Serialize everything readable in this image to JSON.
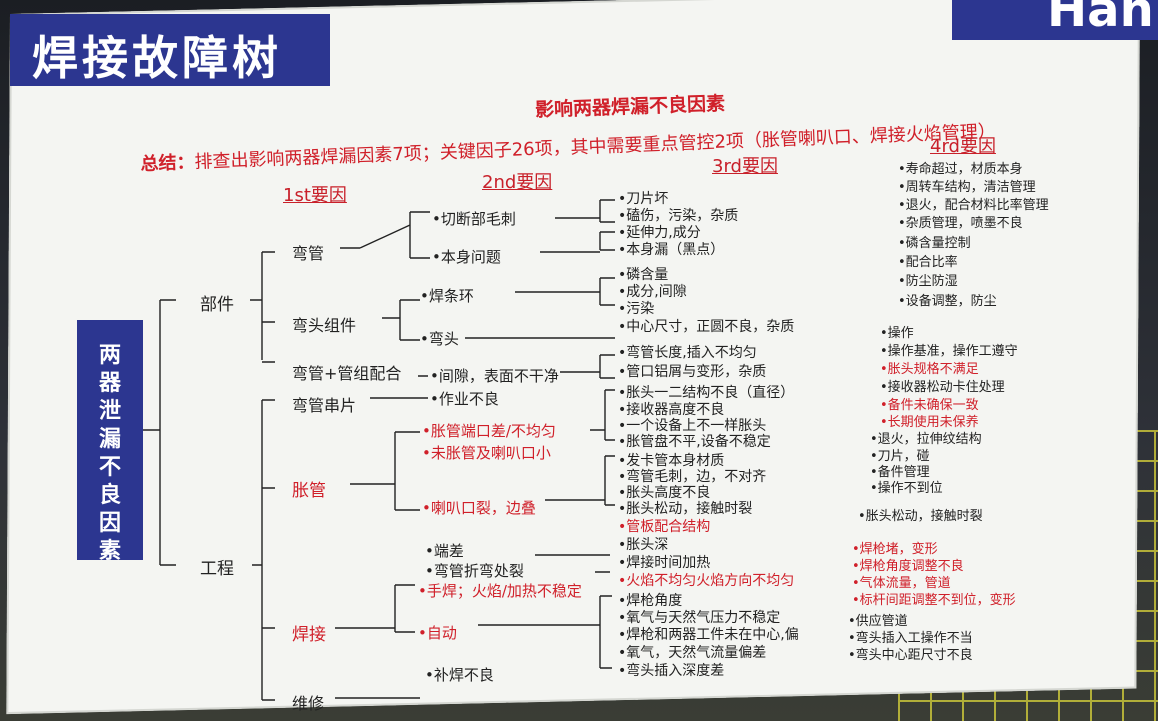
{
  "title": "焊接故障树",
  "corner_text": "Han",
  "subtitle": "影响两器焊漏不良因素",
  "summary": {
    "prefix": "总结：",
    "text": "排查出影响两器焊漏因素7项；关键因子26项，其中需要重点管控2项（胀管喇叭口、焊接火焰管理）"
  },
  "headers": [
    "1st要因",
    "2nd要因",
    "3rd要因",
    "4rd要因"
  ],
  "root": "两器泄漏不良因素",
  "level1": [
    "部件",
    "工程"
  ],
  "level2": [
    "弯管",
    "弯头组件",
    "弯管+管组配合",
    "弯管串片",
    "胀管",
    "焊接",
    "维修"
  ],
  "level3": {
    "wanguan": [
      "•切断部毛刺",
      "•本身问题"
    ],
    "zujian": [
      "•焊条环",
      "•弯头"
    ],
    "peihe": "•间隙，表面不干净",
    "chuanpian": "•作业不良",
    "zhangguan": [
      "•胀管端口差/不均匀",
      "•未胀管及喇叭口小",
      "•喇叭口裂，边叠"
    ],
    "hanjie": [
      "•端差",
      "•弯管折弯处裂",
      "•手焊；火焰/加热不稳定",
      "•自动"
    ],
    "weixiu": "•补焊不良"
  },
  "level4": [
    "•刀片坏",
    "•磕伤，污染，杂质",
    "•延伸力,成分",
    "•本身漏（黑点）",
    "•磷含量",
    "•成分,间隙",
    "•污染",
    "•中心尺寸，正圆不良，杂质",
    "•弯管长度,插入不均匀",
    "•管口铝屑与变形，杂质",
    "•胀头一二结构不良（直径）",
    "•接收器高度不良",
    "•一个设备上不一样胀头",
    "•胀管盘不平,设备不稳定",
    "•发卡管本身材质",
    "•弯管毛刺，边，不对齐",
    "•胀头高度不良",
    "•胀头松动，接触时裂",
    "•管板配合结构",
    "•胀头深",
    "•焊接时间加热",
    "•火焰不均匀火焰方向不均匀",
    "•焊枪角度",
    "•氧气与天然气压力不稳定",
    "•焊枪和两器工件未在中心,偏",
    "•氧气，天然气流量偏差",
    "•弯头插入深度差"
  ],
  "level5": [
    "•寿命超过，材质本身",
    "•周转车结构，清洁管理",
    "•退火，配合材料比率管理",
    "•杂质管理，喷墨不良",
    "•磷含量控制",
    "•配合比率",
    "•防尘防湿",
    "•设备调整，防尘",
    "•操作",
    "•操作基准，操作工遵守",
    "•胀头规格不满足",
    "•接收器松动卡住处理",
    "•备件未确保一致",
    "•长期使用未保养",
    "•退火，拉伸纹结构",
    "•刀片，碰",
    "•备件管理",
    "•操作不到位",
    "•胀头松动，接触时裂",
    "•焊枪堵，变形",
    "•焊枪角度调整不良",
    "•气体流量，管道",
    "•标杆间距调整不到位，变形",
    "•供应管道",
    "•弯头插入工操作不当",
    "•弯头中心距尺寸不良"
  ]
}
